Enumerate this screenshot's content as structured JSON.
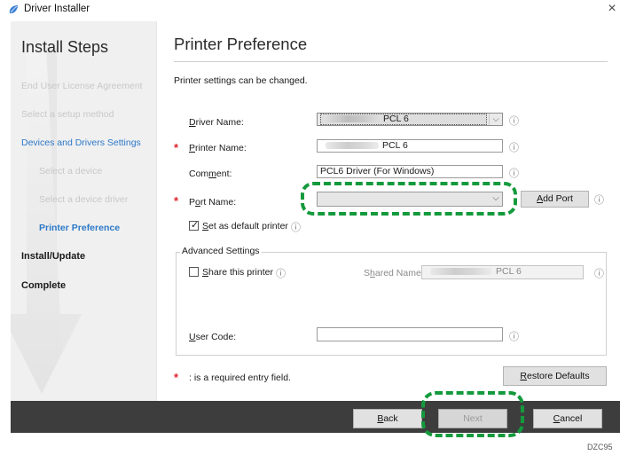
{
  "window": {
    "title": "Driver Installer",
    "close_glyph": "×"
  },
  "steps": {
    "title": "Install Steps",
    "items": [
      {
        "label": "End User License Agreement",
        "state": "done"
      },
      {
        "label": "Select a setup method",
        "state": "done"
      },
      {
        "label": "Devices and Drivers Settings",
        "state": "active"
      },
      {
        "label": "Select a device",
        "state": "done"
      },
      {
        "label": "Select a device driver",
        "state": "done"
      },
      {
        "label": "Printer Preference",
        "state": "current"
      },
      {
        "label": "Install/Update",
        "state": "pending"
      },
      {
        "label": "Complete",
        "state": "pending"
      }
    ]
  },
  "main": {
    "title": "Printer Preference",
    "description": "Printer settings can be changed.",
    "required_mark": "*",
    "info_glyph": "ⓘ",
    "driver_name": {
      "label_prefix": "",
      "label_u": "D",
      "label_rest": "river Name:",
      "value": "PCL 6",
      "dropdown_glyph": "⌵"
    },
    "printer_name": {
      "label_u": "P",
      "label_rest": "rinter Name:",
      "value": "PCL 6"
    },
    "comment": {
      "label_prefix": "Com",
      "label_u": "m",
      "label_rest": "ent:",
      "value": "PCL6 Driver (For Windows)"
    },
    "port_name": {
      "label_prefix": "P",
      "label_u": "o",
      "label_rest": "rt Name:",
      "value": "",
      "dropdown_glyph": "⌵"
    },
    "add_port": {
      "label_u": "A",
      "label_rest": "dd Port"
    },
    "default_printer": {
      "label_prefix": "",
      "label_u": "S",
      "label_rest": "et as default printer",
      "checked": true,
      "check_glyph": "✓"
    },
    "advanced": {
      "title": "Advanced Settings",
      "share": {
        "label_u": "S",
        "label_rest": "hare this printer",
        "checked": false
      },
      "shared_name": {
        "label_prefix": "S",
        "label_u": "h",
        "label_rest": "ared Name:",
        "value": "PCL 6"
      },
      "user_code": {
        "label_u": "U",
        "label_rest": "ser Code:",
        "value": ""
      }
    },
    "required_note": ": is a required entry field.",
    "restore_defaults": {
      "label_u": "R",
      "label_rest": "estore Defaults"
    }
  },
  "nav": {
    "back": {
      "label_u": "B",
      "label_rest": "ack"
    },
    "next": {
      "label": "Next",
      "enabled": false
    },
    "cancel": {
      "label_u": "C",
      "label_rest": "ancel"
    }
  },
  "figure_code": "DZC95",
  "colors": {
    "accent": "#2c78c8",
    "required": "#e0242c",
    "callout": "#149a3c",
    "bottom_bar": "#3d3d3d"
  }
}
